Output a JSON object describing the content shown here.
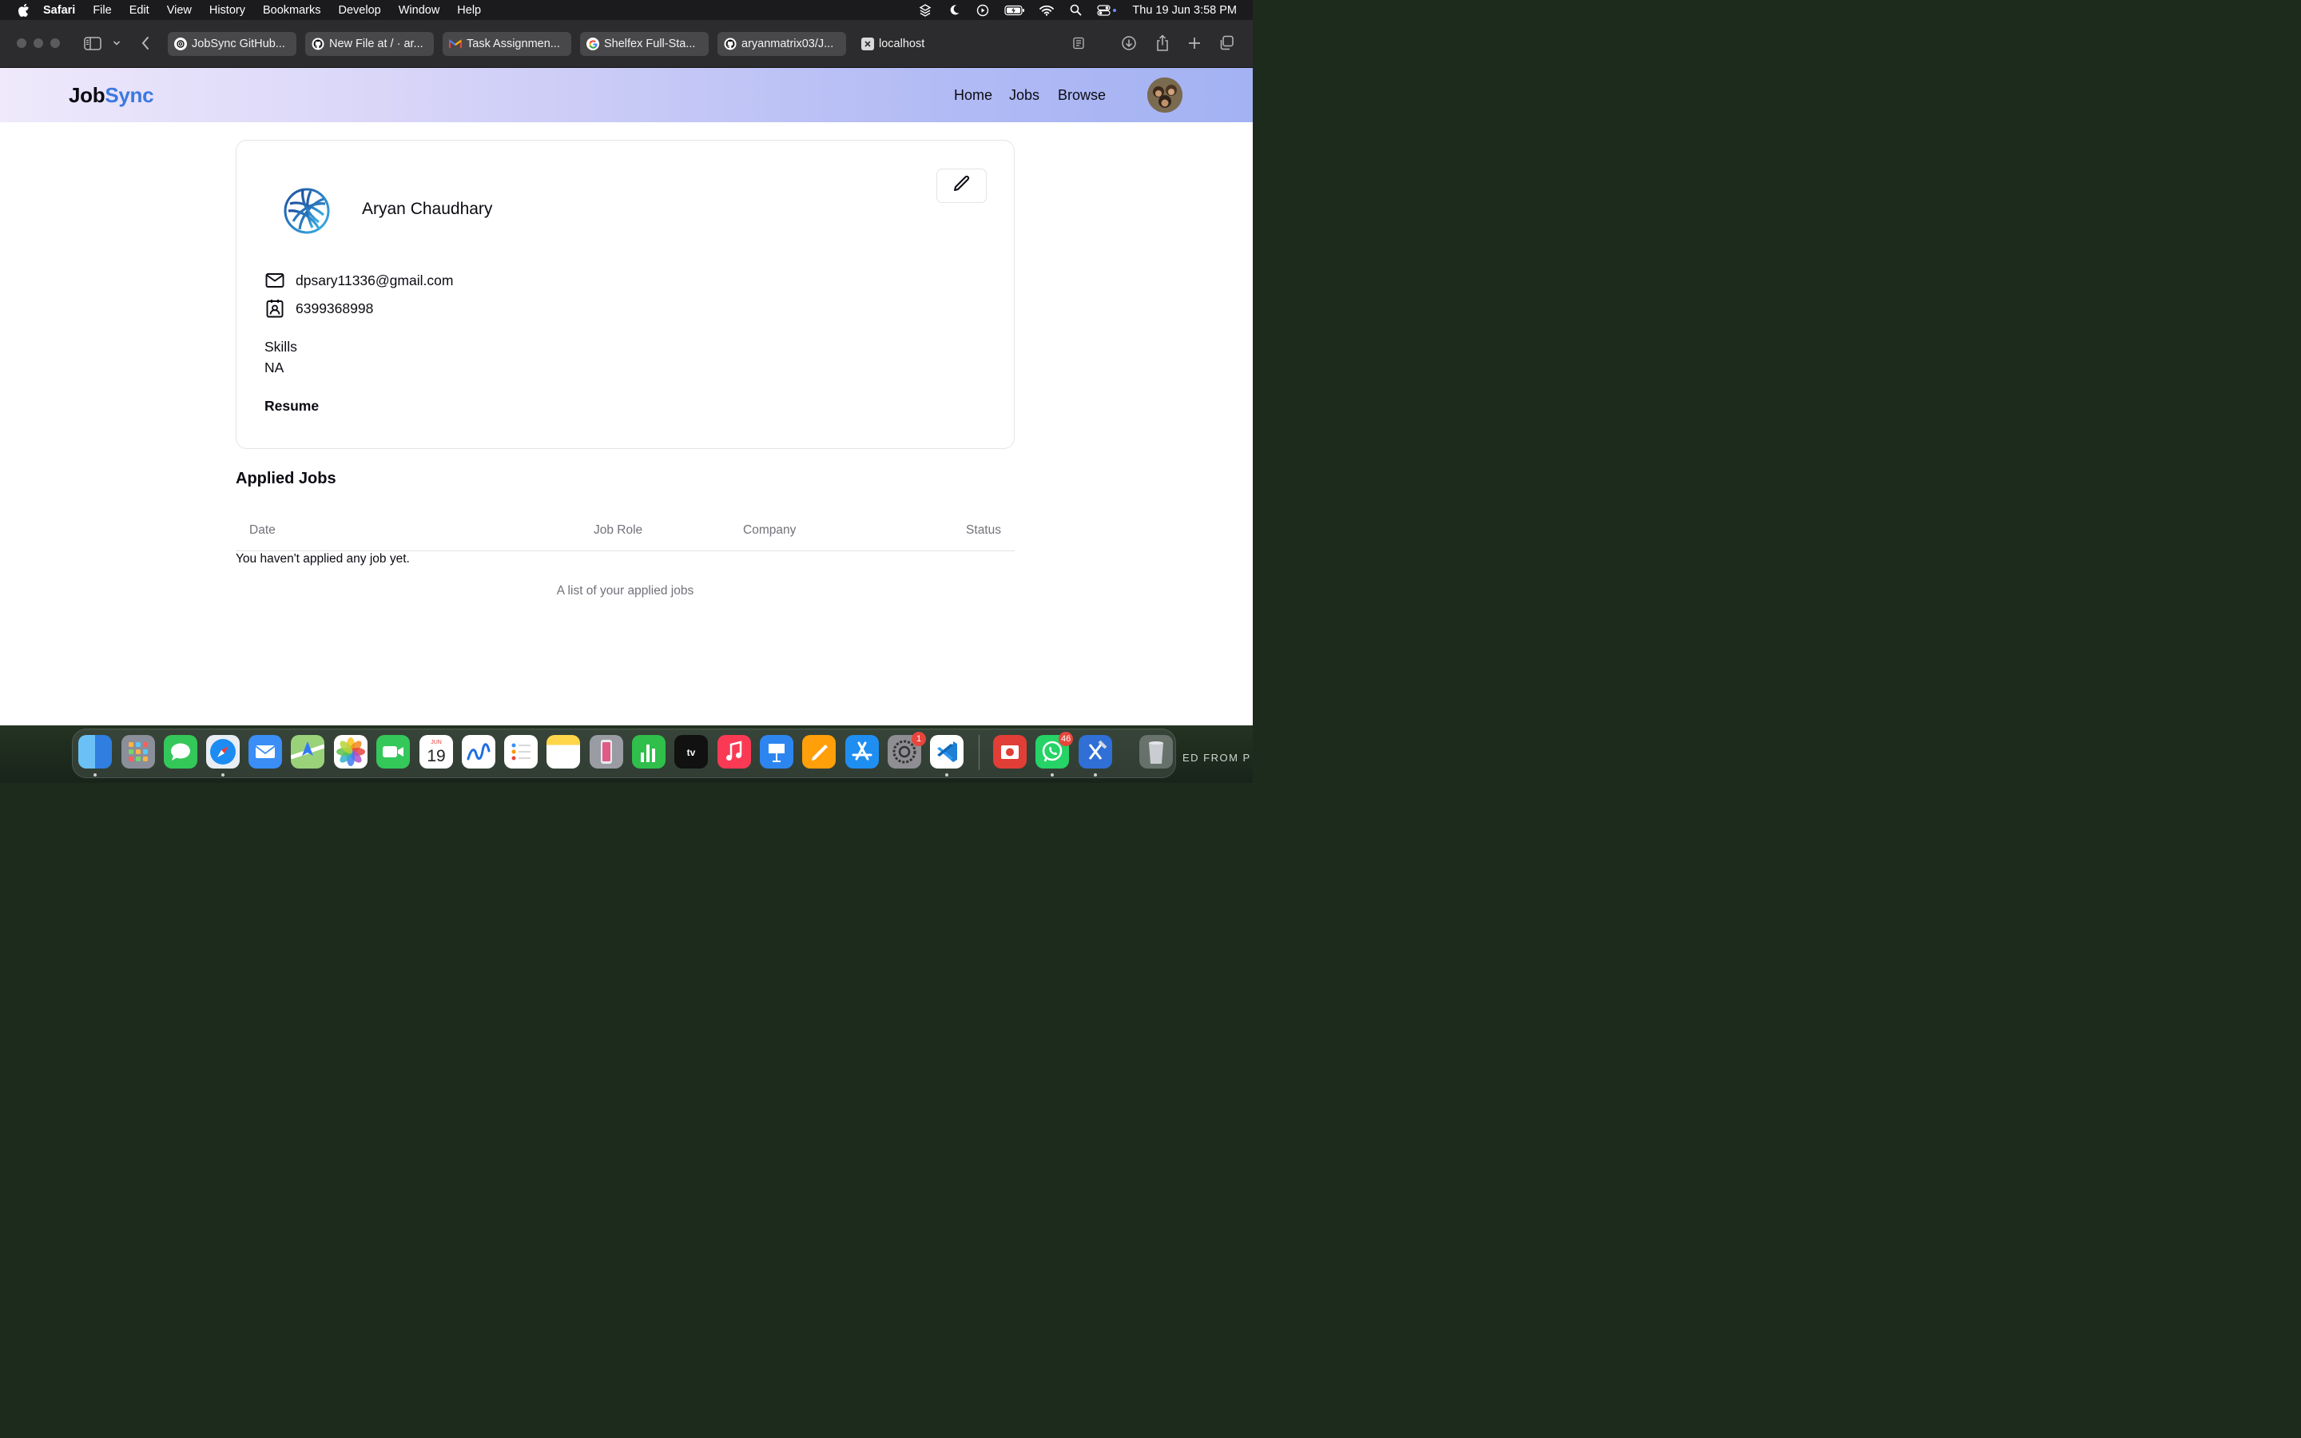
{
  "menubar": {
    "app": "Safari",
    "items": [
      "File",
      "Edit",
      "View",
      "History",
      "Bookmarks",
      "Develop",
      "Window",
      "Help"
    ],
    "clock": "Thu 19 Jun  3:58 PM"
  },
  "tabs": [
    {
      "label": "JobSync GitHub..."
    },
    {
      "label": "New File at / · ar..."
    },
    {
      "label": "Task Assignmen..."
    },
    {
      "label": "Shelfex Full-Sta..."
    },
    {
      "label": "aryanmatrix03/J..."
    },
    {
      "label": "localhost"
    }
  ],
  "site": {
    "logo_part1": "Job",
    "logo_part2": "Sync",
    "logo_color": "#3b78e0",
    "nav": [
      "Home",
      "Jobs",
      "Browse"
    ]
  },
  "profile": {
    "name": "Aryan Chaudhary",
    "email": "dpsary11336@gmail.com",
    "phone": "6399368998",
    "skills_label": "Skills",
    "skills_value": "NA",
    "resume_label": "Resume"
  },
  "applied": {
    "title": "Applied Jobs",
    "columns": [
      "Date",
      "Job Role",
      "Company",
      "Status"
    ],
    "empty_message": "You haven't applied any job yet.",
    "caption": "A list of your applied jobs"
  },
  "dock": {
    "badges": [
      "1",
      "46"
    ],
    "edge_text": "ED FROM P"
  }
}
